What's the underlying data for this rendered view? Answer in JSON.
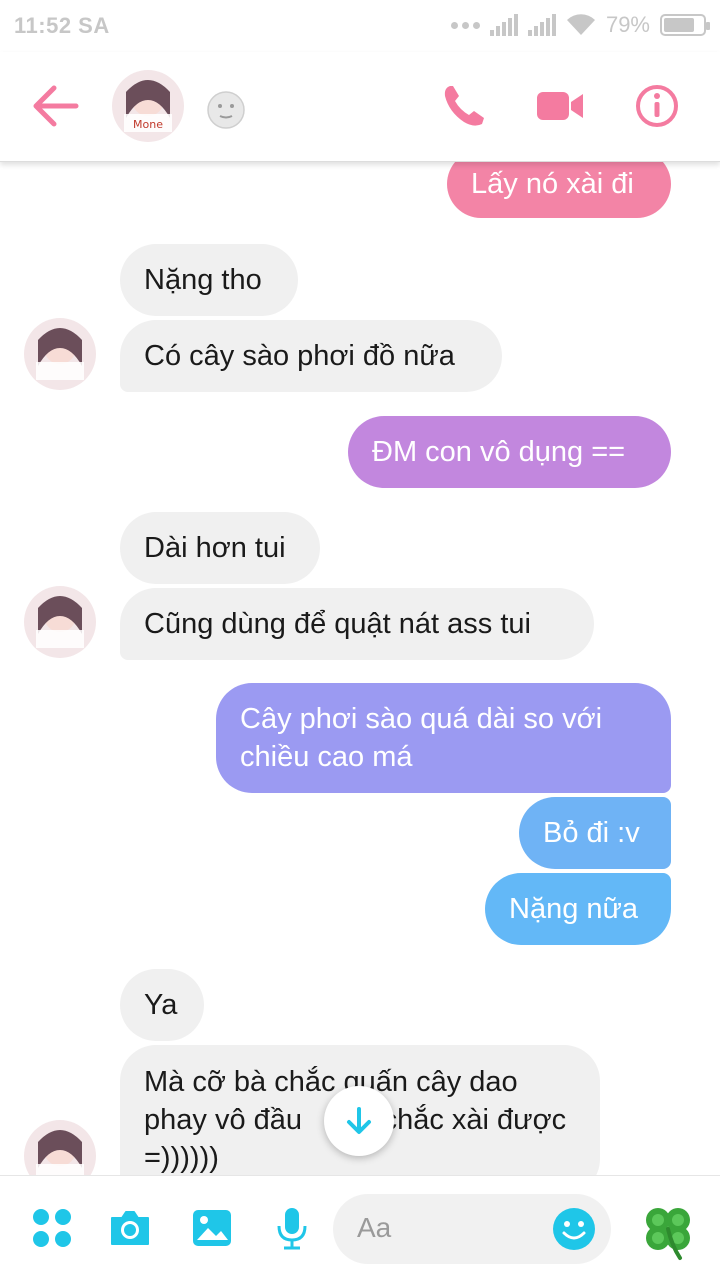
{
  "status_bar": {
    "time": "11:52 SA",
    "battery": "79%"
  },
  "header": {
    "back_icon": "arrow-left-icon",
    "reaction_emoji": "moon-face-emoji",
    "actions": [
      "phone-icon",
      "video-camera-icon",
      "info-icon"
    ],
    "accent_color": "#f47ba0"
  },
  "messages": [
    {
      "direction": "outgoing",
      "text": "Lấy nó xài đi",
      "color": "#f384a6"
    },
    {
      "direction": "incoming",
      "text": "Nặng tho"
    },
    {
      "direction": "incoming",
      "text": "Có cây sào phơi đồ nữa"
    },
    {
      "direction": "outgoing",
      "text": "ĐM con vô dụng ==",
      "color": "#c287de"
    },
    {
      "direction": "incoming",
      "text": "Dài hơn tui"
    },
    {
      "direction": "incoming",
      "text": "Cũng dùng để quật nát ass tui"
    },
    {
      "direction": "outgoing",
      "text": "Cây phơi sào quá dài so với chiều cao má",
      "color": "#9b9af2"
    },
    {
      "direction": "outgoing",
      "text": "Bỏ đi :v",
      "color": "#6fb3f5"
    },
    {
      "direction": "outgoing",
      "text": "Nặng nữa",
      "color": "#63b8f7"
    },
    {
      "direction": "incoming",
      "text": "Ya"
    },
    {
      "direction": "incoming",
      "text": "Mà cỡ bà chắc quấn cây dao phay vô đầu          chắc xài được =))))))"
    }
  ],
  "composer": {
    "placeholder": "Aa",
    "icons": [
      "apps-icon",
      "camera-icon",
      "gallery-icon",
      "microphone-icon",
      "emoji-icon"
    ],
    "like_emoji": "four-leaf-clover-icon",
    "accent_color": "#1fc6e8"
  }
}
